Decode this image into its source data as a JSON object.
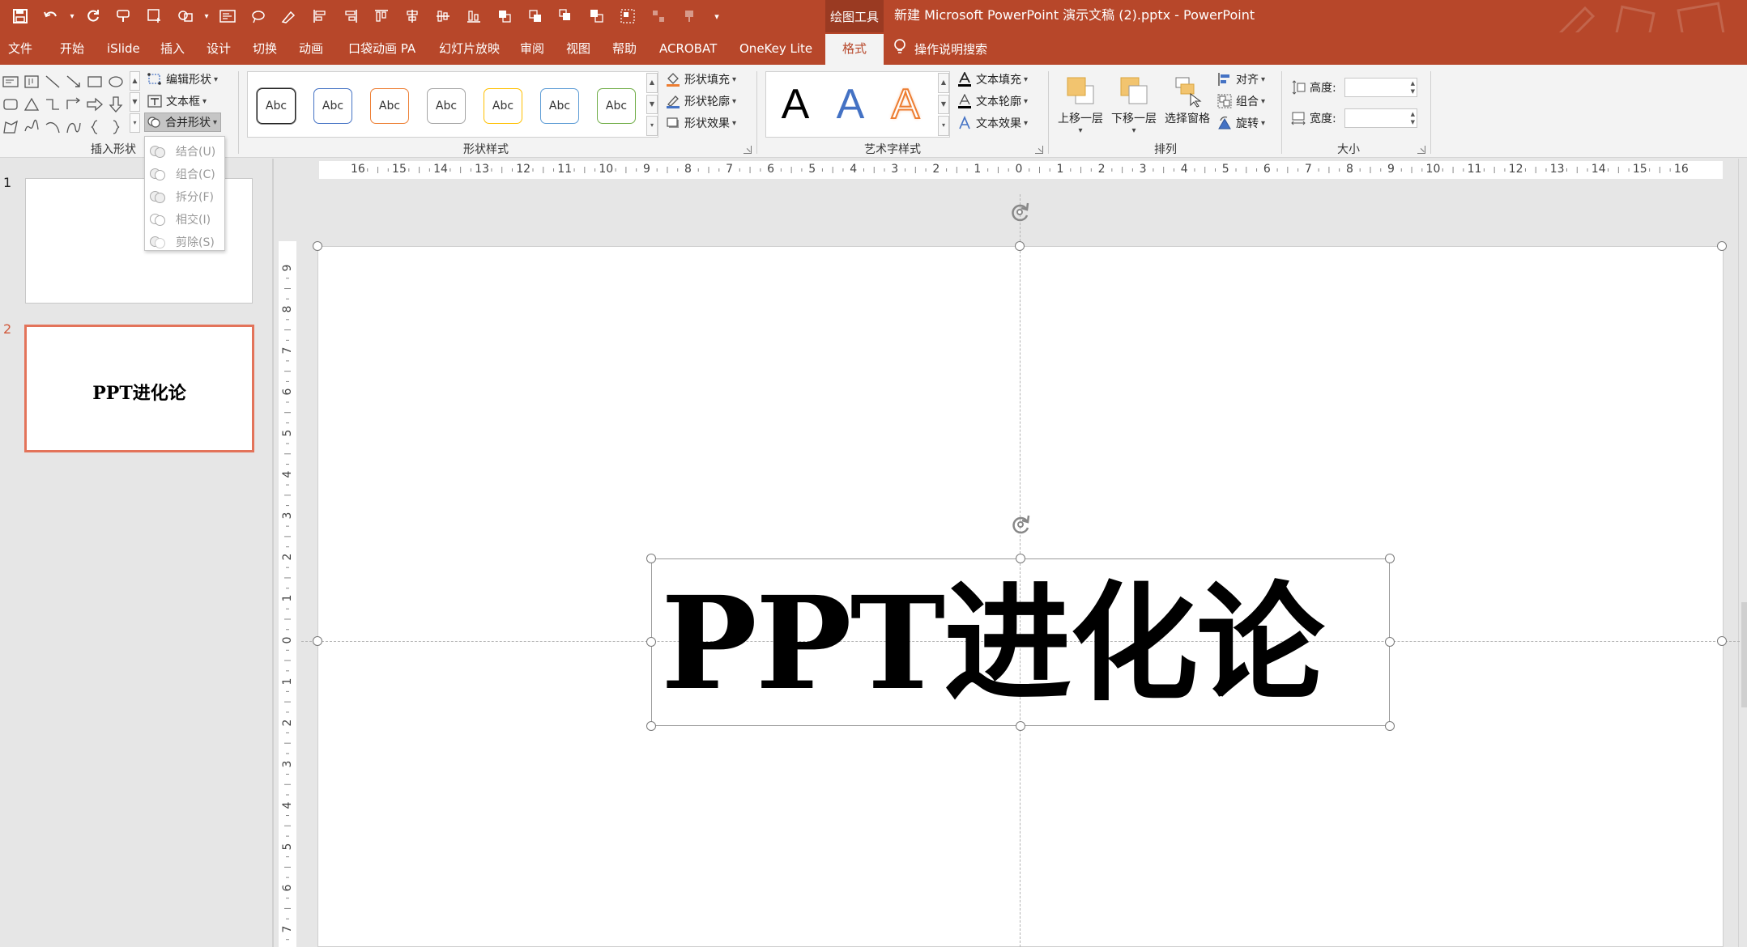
{
  "title_bar": {
    "context_label": "绘图工具",
    "document_title": "新建 Microsoft PowerPoint 演示文稿 (2).pptx  -  PowerPoint",
    "qat_icons": [
      "save-icon",
      "undo-icon",
      "undo-dropdown-icon",
      "redo-icon",
      "format-painter-icon",
      "new-slide-icon",
      "shapes-icon",
      "shapes-dropdown-icon",
      "text-box-icon",
      "lasso-icon",
      "draw-icon",
      "align-left-icon",
      "align-right-icon",
      "align-top-icon",
      "align-center-icon",
      "align-middle-icon",
      "align-bottom-icon",
      "bring-forward-icon",
      "send-backward-icon",
      "bring-front-icon",
      "send-back-icon",
      "group-icon",
      "ungroup-icon",
      "regroup-icon",
      "customize-qat-icon"
    ]
  },
  "tabs": [
    {
      "label": "文件"
    },
    {
      "label": "开始"
    },
    {
      "label": "iSlide"
    },
    {
      "label": "插入"
    },
    {
      "label": "设计"
    },
    {
      "label": "切换"
    },
    {
      "label": "动画"
    },
    {
      "label": "口袋动画 PA"
    },
    {
      "label": "幻灯片放映"
    },
    {
      "label": "审阅"
    },
    {
      "label": "视图"
    },
    {
      "label": "帮助"
    },
    {
      "label": "ACROBAT"
    },
    {
      "label": "OneKey Lite"
    },
    {
      "label": "格式"
    }
  ],
  "tell_me": "操作说明搜索",
  "ribbon": {
    "insert_shapes": {
      "label": "插入形状",
      "edit_shape": "编辑形状",
      "text_box": "文本框",
      "merge_shapes": "合并形状"
    },
    "shape_styles": {
      "label": "形状样式",
      "preset_text": "Abc",
      "presets": [
        {
          "border": "#222222"
        },
        {
          "border": "#4472c4"
        },
        {
          "border": "#ed7d31"
        },
        {
          "border": "#a5a5a5"
        },
        {
          "border": "#ffc000"
        },
        {
          "border": "#5b9bd5"
        },
        {
          "border": "#70ad47"
        }
      ],
      "fill": "形状填充",
      "outline": "形状轮廓",
      "effects": "形状效果"
    },
    "wordart": {
      "label": "艺术字样式",
      "letter": "A",
      "text_fill": "文本填充",
      "text_outline": "文本轮廓",
      "text_effects": "文本效果"
    },
    "arrange": {
      "label": "排列",
      "bring_forward": "上移一层",
      "send_backward": "下移一层",
      "selection_pane": "选择窗格",
      "align": "对齐",
      "group": "组合",
      "rotate": "旋转"
    },
    "size": {
      "label": "大小",
      "height_label": "高度:",
      "width_label": "宽度:",
      "height_value": "",
      "width_value": ""
    }
  },
  "merge_menu": [
    {
      "label": "结合(U)"
    },
    {
      "label": "组合(C)"
    },
    {
      "label": "拆分(F)"
    },
    {
      "label": "相交(I)"
    },
    {
      "label": "剪除(S)"
    }
  ],
  "slides": [
    {
      "number": "1",
      "text": ""
    },
    {
      "number": "2",
      "text": "PPT进化论"
    }
  ],
  "rulers": {
    "horizontal": [
      "16",
      "15",
      "14",
      "13",
      "12",
      "11",
      "10",
      "9",
      "8",
      "7",
      "6",
      "5",
      "4",
      "3",
      "2",
      "1",
      "0",
      "1",
      "2",
      "3",
      "4",
      "5",
      "6",
      "7",
      "8",
      "9",
      "10",
      "11",
      "12",
      "13",
      "14",
      "15",
      "16"
    ],
    "vertical": [
      "9",
      "8",
      "7",
      "6",
      "5",
      "4",
      "3",
      "2",
      "1",
      "0",
      "1",
      "2",
      "3",
      "4",
      "5",
      "6",
      "7"
    ]
  },
  "slide_content": {
    "title_text": "PPT进化论"
  },
  "colors": {
    "accent": "#b7472a",
    "selected_thumb_border": "#e3735a"
  }
}
